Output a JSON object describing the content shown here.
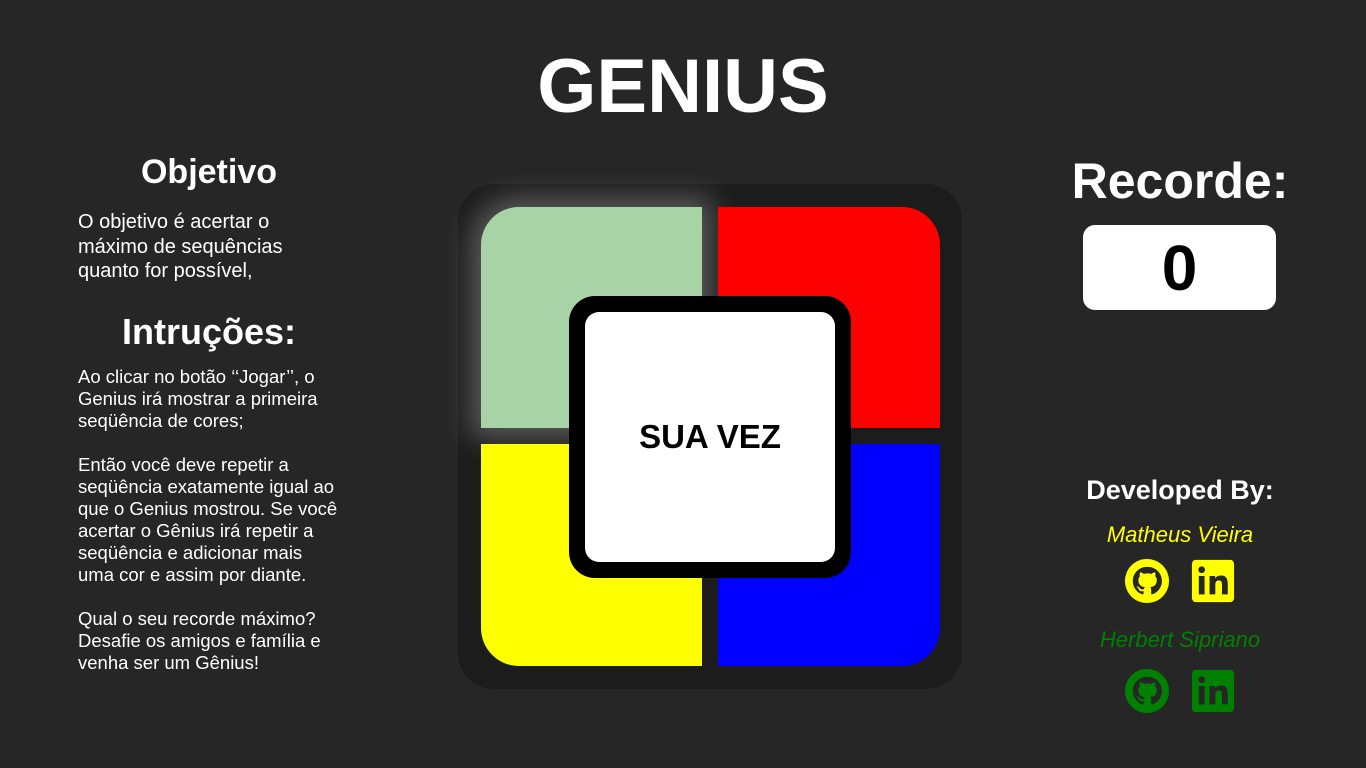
{
  "title": "GENIUS",
  "objective": {
    "heading": "Objetivo",
    "text": "   O objetivo é acertar o máximo de sequências quanto for possível,"
  },
  "instructions": {
    "heading": "Intruções:",
    "paragraphs": [
      "    Ao clicar no botão ‘‘Jogar’’, o Genius irá mostrar a primeira seqüência de cores;",
      "    Então você deve repetir a seqüência exatamente igual ao que o Genius mostrou. Se você acertar o Gênius irá repetir a seqüência e adicionar mais uma cor e assim por diante.",
      "Qual o seu recorde máximo? Desafie os amigos e família e venha ser um Gênius!"
    ]
  },
  "board": {
    "center_label": "SUA VEZ",
    "pads": [
      {
        "name": "green",
        "color": "#a8d3a6",
        "lit": true
      },
      {
        "name": "red",
        "color": "#ff0000",
        "lit": false
      },
      {
        "name": "yellow",
        "color": "#ffff00",
        "lit": false
      },
      {
        "name": "blue",
        "color": "#0000ff",
        "lit": false
      }
    ]
  },
  "record": {
    "label": "Recorde:",
    "value": "0"
  },
  "developers": {
    "label": "Developed By:",
    "people": [
      {
        "name": "Matheus Vieira",
        "color": "#ffff00",
        "icons": [
          "github-icon",
          "linkedin-icon"
        ]
      },
      {
        "name": "Herbert Sipriano",
        "color": "#008000",
        "icons": [
          "github-icon",
          "linkedin-icon"
        ]
      }
    ]
  }
}
